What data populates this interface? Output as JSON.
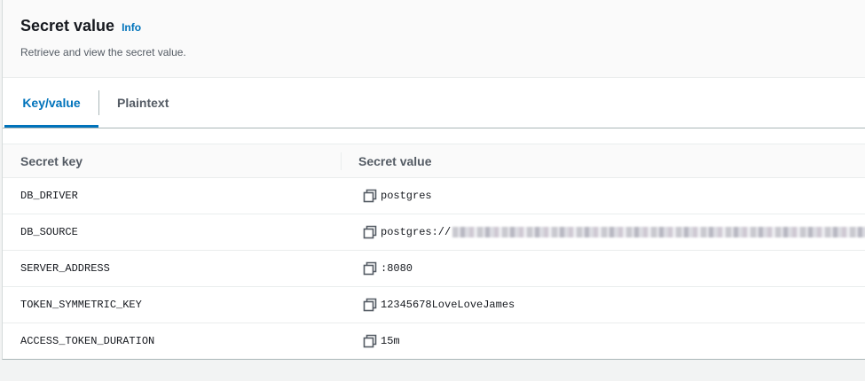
{
  "header": {
    "title": "Secret value",
    "info_link": "Info",
    "description": "Retrieve and view the secret value."
  },
  "tabs": [
    {
      "label": "Key/value",
      "active": true
    },
    {
      "label": "Plaintext",
      "active": false
    }
  ],
  "table": {
    "columns": [
      "Secret key",
      "Secret value"
    ],
    "rows": [
      {
        "key": "DB_DRIVER",
        "value": "postgres"
      },
      {
        "key": "DB_SOURCE",
        "value": "postgres://",
        "redacted": true
      },
      {
        "key": "SERVER_ADDRESS",
        "value": ":8080"
      },
      {
        "key": "TOKEN_SYMMETRIC_KEY",
        "value": "12345678LoveLoveJames"
      },
      {
        "key": "ACCESS_TOKEN_DURATION",
        "value": "15m"
      }
    ]
  },
  "colors": {
    "accent": "#0073bb",
    "text": "#16191f",
    "muted": "#545b64",
    "border": "#eaeded"
  },
  "icons": {
    "copy": "copy-icon"
  }
}
